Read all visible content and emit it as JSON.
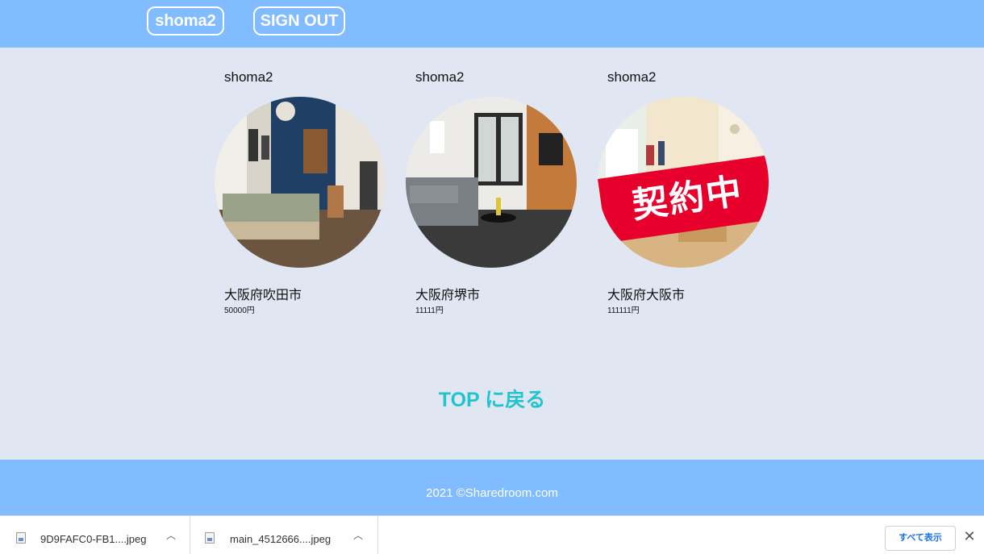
{
  "header": {
    "user_label": "shoma2",
    "signout_label": "SIGN OUT"
  },
  "listings": [
    {
      "owner": "shoma2",
      "city": "大阪府吹田市",
      "price": "50000円"
    },
    {
      "owner": "shoma2",
      "city": "大阪府堺市",
      "price": "11111円"
    },
    {
      "owner": "shoma2",
      "city": "大阪府大阪市",
      "price": "111111円",
      "badge": "契約中"
    }
  ],
  "back_link": "TOP に戻る",
  "footer": {
    "copyright": "2021 ©Sharedroom.com"
  },
  "downloads": {
    "items": [
      {
        "name": "9D9FAFC0-FB1....jpeg",
        "icon": "file-icon"
      },
      {
        "name": "main_4512666....jpeg",
        "icon": "file-icon"
      }
    ],
    "show_all_label": "すべて表示"
  },
  "colors": {
    "header_bg": "#80bcff",
    "page_bg": "#e0e7f3",
    "accent_link": "#22c4cf",
    "badge_red": "#e8002d"
  }
}
